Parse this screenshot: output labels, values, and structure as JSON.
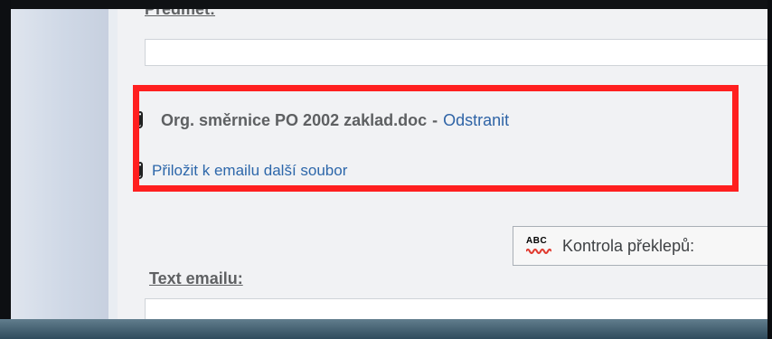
{
  "form": {
    "subject_label": "Předmět:",
    "subject_value": "",
    "text_label": "Text emailu:",
    "text_value": ""
  },
  "attachments": {
    "items": [
      {
        "filename": "Org. směrnice PO 2002 zaklad.doc",
        "separator": "-",
        "remove_label": "Odstranit"
      }
    ],
    "add_more_label": "Přiložit k emailu další soubor"
  },
  "toolbar": {
    "spellcheck_label": "Kontrola překlepů:",
    "spellcheck_icon": "abc-spellcheck-icon",
    "spellcheck_abc": "ABC"
  },
  "colors": {
    "highlight": "#ff1f1f",
    "link": "#2f64a6"
  }
}
